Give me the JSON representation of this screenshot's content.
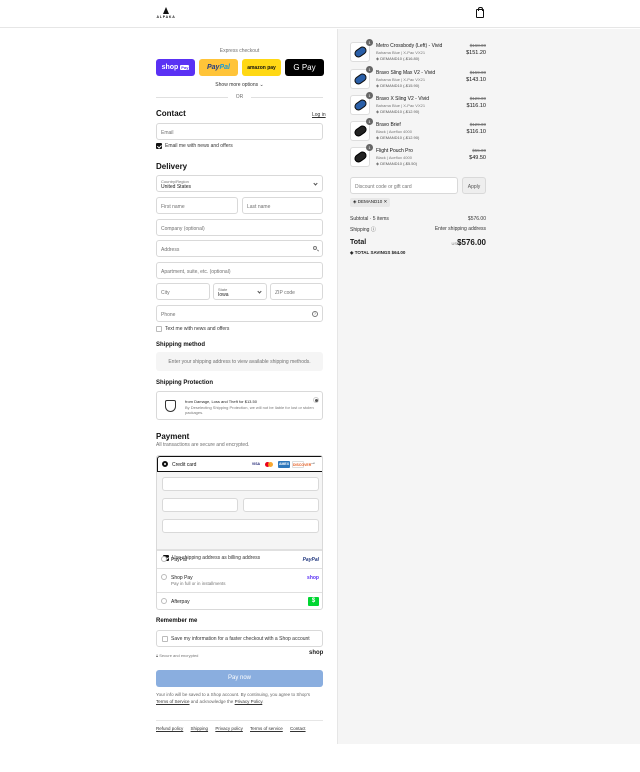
{
  "brand": {
    "name": "ALPAKA"
  },
  "express": {
    "title": "Express checkout",
    "shoppay": "shop",
    "shoppay_badge": "Pay",
    "paypal_a": "Pay",
    "paypal_b": "Pal",
    "amazon": "amazon pay",
    "gpay": "G Pay",
    "more": "Show more options ⌄",
    "or": "OR"
  },
  "contact": {
    "heading": "Contact",
    "login": "Log in",
    "email_placeholder": "Email",
    "news_label": "Email me with news and offers"
  },
  "delivery": {
    "heading": "Delivery",
    "country_label": "Country/Region",
    "country_value": "United States",
    "first_name": "First name",
    "last_name": "Last name",
    "company": "Company (optional)",
    "address": "Address",
    "apartment": "Apartment, suite, etc. (optional)",
    "city": "City",
    "state_label": "State",
    "state_value": "Iowa",
    "zip": "ZIP code",
    "phone": "Phone",
    "text_label": "Text me with news and offers"
  },
  "shipping": {
    "heading": "Shipping method",
    "notice": "Enter your shipping address to view available shipping methods."
  },
  "protection": {
    "heading": "Shipping Protection",
    "title": "from Damage, Loss and Theft for $13.50",
    "desc": "By Deselecting Shipping Protection, we will not be liable for lost or stolen packages."
  },
  "payment": {
    "heading": "Payment",
    "sub": "All transactions are secure and encrypted.",
    "credit_card": "Credit card",
    "card_logos": [
      "VISA",
      "",
      "AMEX",
      "DISCOVER"
    ],
    "more_arrow": "→",
    "billing_label": "Use shipping address as billing address",
    "methods": [
      {
        "label": "PayPal",
        "logo": "PayPal",
        "sub": ""
      },
      {
        "label": "Shop Pay",
        "logo": "shop",
        "sub": "Pay in full or in installments"
      },
      {
        "label": "Afterpay",
        "logo": "$",
        "sub": ""
      }
    ]
  },
  "remember": {
    "heading": "Remember me",
    "label": "Save my information for a faster checkout with a Shop account",
    "secure": "Secure and encrypted",
    "shop": "shop"
  },
  "paynow": "Pay now",
  "legal": {
    "text1": "Your info will be saved to a Shop account. By continuing, you agree to Shop's",
    "tos": "Terms of Service",
    "text2": "and acknowledge the",
    "privacy": "Privacy Policy",
    "end": "."
  },
  "footer": [
    "Refund policy",
    "Shipping",
    "Privacy policy",
    "Terms of service",
    "Contact"
  ],
  "cart": {
    "items": [
      {
        "qty": "1",
        "name": "Metro Crossbody (Left) - Vivid",
        "variant": "Bahama Blue | X-Pac VX21",
        "discount": "DEMAND10 (-$16.80)",
        "orig": "$168.00",
        "price": "$151.20",
        "color": "blue"
      },
      {
        "qty": "1",
        "name": "Bravo Sling Max V2 - Vivid",
        "variant": "Bahama Blue | X-Pac VX21",
        "discount": "DEMAND10 (-$15.90)",
        "orig": "$159.00",
        "price": "$143.10",
        "color": "blue"
      },
      {
        "qty": "1",
        "name": "Bravo X Sling V2 - Vivid",
        "variant": "Bahama Blue | X-Pac VX21",
        "discount": "DEMAND10 (-$12.90)",
        "orig": "$129.00",
        "price": "$116.10",
        "color": "blue"
      },
      {
        "qty": "1",
        "name": "Bravo Brief",
        "variant": "Black | Aceflux 4000",
        "discount": "DEMAND10 (-$12.90)",
        "orig": "$129.00",
        "price": "$116.10",
        "color": "black"
      },
      {
        "qty": "1",
        "name": "Flight Pouch Pro",
        "variant": "Black | Aceflux 4000",
        "discount": "DEMAND10 (-$5.50)",
        "orig": "$55.00",
        "price": "$49.50",
        "color": "black"
      }
    ],
    "discount_placeholder": "Discount code or gift card",
    "apply": "Apply",
    "code_tag": "DEMAND10",
    "subtotal_label": "Subtotal · 5 items",
    "subtotal": "$576.00",
    "shipping_label": "Shipping ⓘ",
    "shipping_value": "Enter shipping address",
    "total_label": "Total",
    "currency": "USD",
    "total": "$576.00",
    "savings_label": "TOTAL SAVINGS",
    "savings": "$64.00"
  }
}
